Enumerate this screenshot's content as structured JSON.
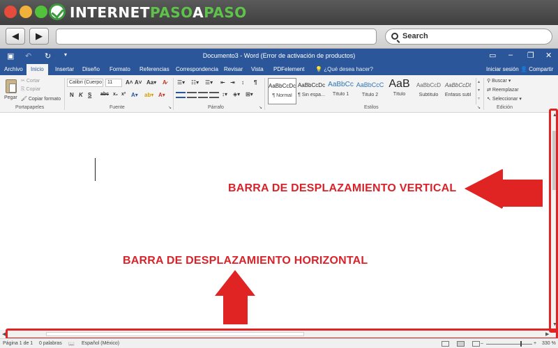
{
  "logo": {
    "part1": "INTERNET",
    "part2": "PASO",
    "part3": "A",
    "part4": "PASO"
  },
  "browser": {
    "back": "◀",
    "forward": "▶",
    "search_placeholder": "Search"
  },
  "word": {
    "title": "Documento3 - Word (Error de activación de productos)",
    "tabs": [
      "Archivo",
      "Inicio",
      "Insertar",
      "Diseño",
      "Formato",
      "Referencias",
      "Correspondencia",
      "Revisar",
      "Vista",
      "PDFelement"
    ],
    "active_tab": "Inicio",
    "tell_me": "¿Qué desea hacer?",
    "sign_in": "Iniciar sesión",
    "share": "Compartir",
    "clipboard": {
      "paste": "Pegar",
      "cut": "Cortar",
      "copy": "Copiar",
      "format_painter": "Copiar formato",
      "label": "Portapapeles"
    },
    "font": {
      "name": "Calibri (Cuerpo",
      "size": "11",
      "label": "Fuente"
    },
    "paragraph": {
      "label": "Párrafo"
    },
    "styles": {
      "label": "Estilos",
      "items": [
        {
          "preview": "AaBbCcDc",
          "name": "¶ Normal"
        },
        {
          "preview": "AaBbCcDc",
          "name": "¶ Sin espa..."
        },
        {
          "preview": "AaBbCc",
          "name": "Título 1"
        },
        {
          "preview": "AaBbCcC",
          "name": "Título 2"
        },
        {
          "preview": "AaB",
          "name": "Título"
        },
        {
          "preview": "AaBbCcD",
          "name": "Subtítulo"
        },
        {
          "preview": "AaBbCcDt",
          "name": "Énfasis sutil"
        }
      ]
    },
    "editing": {
      "find": "Buscar",
      "replace": "Reemplazar",
      "select": "Seleccionar",
      "label": "Edición"
    }
  },
  "annotations": {
    "vertical": "BARRA DE DESPLAZAMIENTO VERTICAL",
    "horizontal": "BARRA DE DESPLAZAMIENTO HORIZONTAL",
    "color": "#d8232a"
  },
  "status": {
    "page": "Página 1 de 1",
    "words": "0 palabras",
    "language": "Español (México)",
    "zoom": "330 %"
  }
}
